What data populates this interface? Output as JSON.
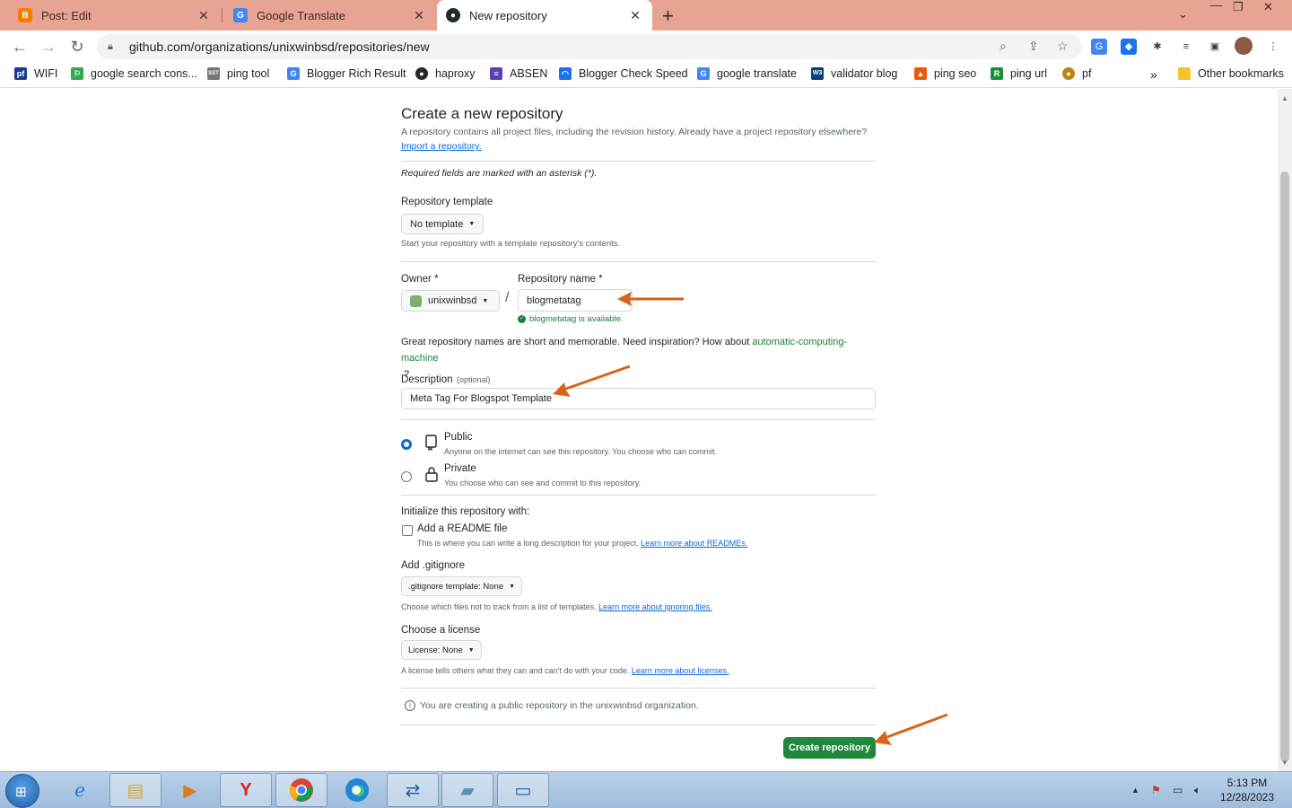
{
  "browser": {
    "tabs": [
      {
        "title": "Post: Edit",
        "icon": "blogger-icon",
        "color": "#f57d00"
      },
      {
        "title": "Google Translate",
        "icon": "translate-icon",
        "color": "#4285f4"
      },
      {
        "title": "New repository",
        "icon": "github-icon",
        "color": "#24292f"
      }
    ],
    "url": "github.com/organizations/unixwinbsd/repositories/new",
    "bookmarks": [
      {
        "label": "WIFI",
        "color": "#1a3d8f"
      },
      {
        "label": "google search cons...",
        "color": "#34a853"
      },
      {
        "label": "ping tool",
        "color": "#777777"
      },
      {
        "label": "Blogger Rich Result",
        "color": "#4285f4"
      },
      {
        "label": "haproxy",
        "color": "#24292f"
      },
      {
        "label": "ABSEN",
        "color": "#5b3fb5"
      },
      {
        "label": "Blogger Check Speed",
        "color": "#1a73e8"
      },
      {
        "label": "google translate",
        "color": "#4285f4"
      },
      {
        "label": "validator blog",
        "color": "#0b3f7a"
      },
      {
        "label": "ping seo",
        "color": "#e8590c"
      },
      {
        "label": "ping url",
        "color": "#1e8e3e"
      },
      {
        "label": "pf",
        "color": "#b8860b"
      }
    ],
    "other_bookmarks": "Other bookmarks"
  },
  "page": {
    "title": "Create a new repository",
    "intro": "A repository contains all project files, including the revision history. Already have a project repository elsewhere?",
    "import_link": "Import a repository.",
    "required_note": "Required fields are marked with an asterisk (*).",
    "template": {
      "label": "Repository template",
      "value": "No template",
      "help": "Start your repository with a template repository's contents."
    },
    "owner": {
      "label": "Owner *",
      "value": "unixwinbsd"
    },
    "slash": "/",
    "repo_name": {
      "label": "Repository name *",
      "value": "blogmetatag",
      "status": "blogmetatag is available."
    },
    "inspiration": {
      "text": "Great repository names are short and memorable. Need inspiration? How about",
      "suggestion": "automatic-computing-machine",
      "end": "?"
    },
    "description": {
      "label": "Description",
      "optional": "(optional)",
      "value": "Meta Tag For Blogspot Template"
    },
    "visibility": {
      "public": {
        "label": "Public",
        "help": "Anyone on the internet can see this repository. You choose who can commit."
      },
      "private": {
        "label": "Private",
        "help": "You choose who can see and commit to this repository."
      }
    },
    "init": {
      "heading": "Initialize this repository with:",
      "readme_label": "Add a README file",
      "readme_help": "This is where you can write a long description for your project.",
      "readme_link": "Learn more about READMEs."
    },
    "gitignore": {
      "heading": "Add .gitignore",
      "value": ".gitignore template: None",
      "help": "Choose which files not to track from a list of templates.",
      "link": "Learn more about ignoring files."
    },
    "license": {
      "heading": "Choose a license",
      "value": "License: None",
      "help": "A license tells others what they can and can't do with your code.",
      "link": "Learn more about licenses."
    },
    "notice": "You are creating a public repository in the unixwinbsd organization.",
    "create_button": "Create repository"
  },
  "annotation_color": "#d4651b",
  "taskbar": {
    "time": "5:13 PM",
    "date": "12/28/2023"
  }
}
